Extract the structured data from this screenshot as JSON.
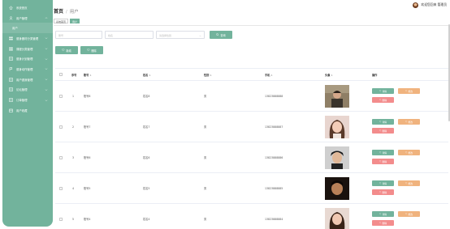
{
  "sidebar": {
    "items": [
      {
        "label": "系统首页",
        "icon": "home-icon",
        "has_children": false
      },
      {
        "label": "用户管理",
        "icon": "user-icon",
        "has_children": true,
        "expanded": true
      },
      {
        "label": "用户",
        "sub": true
      },
      {
        "label": "健身器材分类管理",
        "icon": "grid-icon",
        "has_children": true
      },
      {
        "label": "课程分类管理",
        "icon": "grid-icon",
        "has_children": true
      },
      {
        "label": "健身计划管理",
        "icon": "list-icon",
        "has_children": true
      },
      {
        "label": "健身动作管理",
        "icon": "flag-icon",
        "has_children": true
      },
      {
        "label": "用户健身管理",
        "icon": "list-icon",
        "has_children": true
      },
      {
        "label": "论坛管理",
        "icon": "list-icon",
        "has_children": true
      },
      {
        "label": "订单管理",
        "icon": "list-icon",
        "has_children": true
      },
      {
        "label": "用户收藏",
        "icon": "calendar-icon",
        "has_children": false
      }
    ]
  },
  "header": {
    "user_text": "欢迎您回来 管理员",
    "breadcrumb_home": "首页",
    "breadcrumb_sep": "/",
    "breadcrumb_current": "用户",
    "tags": [
      {
        "label": "系统首页",
        "active": false
      },
      {
        "label": "用户",
        "active": true
      }
    ]
  },
  "filters": {
    "account_placeholder": "账号",
    "name_placeholder": "姓名",
    "gender_placeholder": "请选择性别",
    "search_label": "查询"
  },
  "actions": {
    "add_label": "新增",
    "delete_label": "删除"
  },
  "table": {
    "headers": [
      "序号",
      "账号",
      "姓名",
      "性别",
      "手机",
      "头像",
      "操作"
    ],
    "rows": [
      {
        "index": "1",
        "account": "账号8",
        "name": "姓名8",
        "gender": "男",
        "phone": "13823888888",
        "photo": "photo-1"
      },
      {
        "index": "2",
        "account": "账号7",
        "name": "姓名7",
        "gender": "男",
        "phone": "13823888887",
        "photo": "photo-2"
      },
      {
        "index": "3",
        "account": "账号6",
        "name": "姓名6",
        "gender": "男",
        "phone": "13823888886",
        "photo": "photo-3"
      },
      {
        "index": "4",
        "account": "账号5",
        "name": "姓名5",
        "gender": "男",
        "phone": "13823888885",
        "photo": "photo-4"
      },
      {
        "index": "5",
        "account": "账号4",
        "name": "姓名4",
        "gender": "男",
        "phone": "13823888884",
        "photo": "photo-5"
      }
    ],
    "op_detail": "详情",
    "op_edit": "修改",
    "op_delete": "删除"
  },
  "colors": {
    "accent": "#72b39c",
    "edit": "#f0b37e",
    "delete": "#f38c8c"
  }
}
